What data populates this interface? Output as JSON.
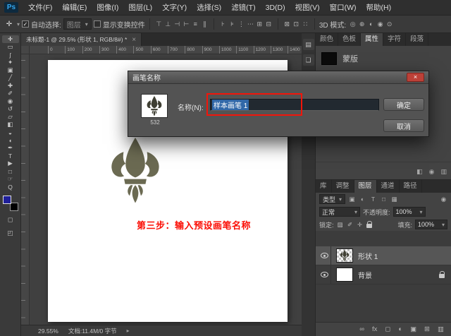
{
  "menu": {
    "logo": "Ps",
    "items": [
      "文件(F)",
      "编辑(E)",
      "图像(I)",
      "图层(L)",
      "文字(Y)",
      "选择(S)",
      "滤镜(T)",
      "3D(D)",
      "视图(V)",
      "窗口(W)",
      "帮助(H)"
    ]
  },
  "options": {
    "tool_icon": "✛",
    "auto_select_label": "自动选择:",
    "auto_select_value": "图层",
    "show_transform_label": "显示变换控件",
    "mode_3d_label": "3D 模式:",
    "align_icons_1": [
      "⊤",
      "⊥",
      "⊣",
      "⊢",
      "≡",
      "∥"
    ],
    "align_icons_2": [
      "⊦",
      "⊧",
      "⋮",
      "⋯",
      "⊞",
      "⊟"
    ],
    "align_icons_3": [
      "⊠",
      "⊡",
      "∷"
    ],
    "mode_3d_icons": [
      "◎",
      "⊕",
      "◐",
      "◉",
      "⊙"
    ]
  },
  "doc_tab": {
    "title": "未标题-1 @ 29.5% (形状 1, RGB/8#) *",
    "close": "×"
  },
  "ruler": {
    "h_ticks": [
      "0",
      "100",
      "200",
      "300",
      "400",
      "500",
      "600",
      "700",
      "800",
      "900",
      "1000",
      "1100",
      "1200",
      "1300",
      "1400"
    ]
  },
  "canvas": {
    "annotation": "第三步：输入预设画笔名称",
    "annotation_color": "#fb0e05"
  },
  "tools": [
    "✛",
    "▭",
    "ʃ",
    "✦",
    "▣",
    "╱",
    "✚",
    "✐",
    "◉",
    "↺",
    "▱",
    "◧",
    "◒",
    "◖",
    "✒",
    "T",
    "▶",
    "□",
    "☞",
    "Q"
  ],
  "swatches": {
    "foreground": "#20209a",
    "background": "#000000"
  },
  "rail_icons": [
    "◻",
    "◰"
  ],
  "dialog": {
    "title": "画笔名称",
    "close_label": "×",
    "preview_size": "532",
    "name_label": "名称(N):",
    "name_value": "样本画笔 1",
    "ok_label": "确定",
    "cancel_label": "取消"
  },
  "right": {
    "dock_icons": [
      "▤",
      "❏"
    ],
    "tabs1": [
      "颜色",
      "色板",
      "属性",
      "字符",
      "段落"
    ],
    "properties": {
      "mask_label": "蒙版",
      "icons": [
        "◧",
        "◉",
        "▥"
      ]
    },
    "tabs2": [
      "库",
      "调整",
      "图层",
      "通道",
      "路径"
    ],
    "layers": {
      "filter_label": "类型",
      "filter_icons": [
        "▣",
        "◐",
        "T",
        "□",
        "▦"
      ],
      "filter_toggle": "◉",
      "blend_mode": "正常",
      "opacity_label": "不透明度:",
      "opacity_value": "100%",
      "lock_label": "锁定:",
      "lock_icons": [
        "▨",
        "✐",
        "✛"
      ],
      "fill_label": "填充:",
      "fill_value": "100%",
      "items": [
        {
          "name": "形状 1"
        },
        {
          "name": "背景"
        }
      ],
      "bottom_icons": [
        "∞",
        "fx",
        "◻",
        "◐",
        "▣",
        "⊞",
        "▥"
      ]
    }
  },
  "status": {
    "zoom": "29.55%",
    "doc_info": "文档:11.4M/0 字节",
    "arrow": "▸"
  },
  "glyphs": {
    "caret": "▾",
    "check": "✓"
  },
  "colors": {
    "fleur_canvas": "#6b6a52",
    "fleur_dark": "#3f3f33",
    "selection_blue": "#3168a8",
    "annotation_red": "#fb0e05"
  }
}
